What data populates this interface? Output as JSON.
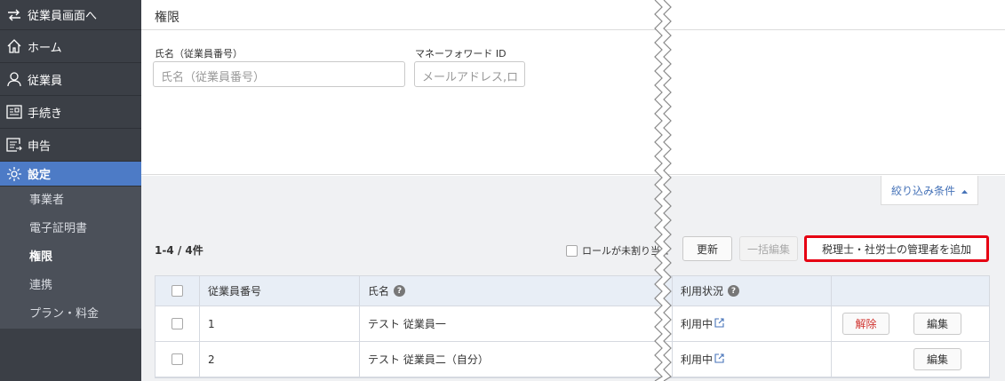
{
  "sidebar": {
    "switch_label": "従業員画面へ",
    "items": [
      {
        "label": "ホーム",
        "icon": "home-icon"
      },
      {
        "label": "従業員",
        "icon": "person-icon"
      },
      {
        "label": "手続き",
        "icon": "procedure-icon"
      },
      {
        "label": "申告",
        "icon": "declaration-icon"
      }
    ],
    "active_label": "設定",
    "sub_items": [
      "事業者",
      "電子証明書",
      "権限",
      "連携",
      "プラン・料金"
    ]
  },
  "page": {
    "title": "権限"
  },
  "filter": {
    "name_label": "氏名（従業員番号）",
    "name_placeholder": "氏名（従業員番号）",
    "mf_label": "マネーフォワード ID",
    "mf_placeholder": "メールアドレス,ロ",
    "collapse_label": "絞り込み条件",
    "collapse_icon": "caret-up-icon"
  },
  "list": {
    "count": "1-4 / 4件",
    "unassigned_label": "ロールが未割り当て",
    "refresh_label": "更新",
    "bulk_edit_label": "一括編集",
    "add_admin_label": "税理士・社労士の管理者を追加"
  },
  "table": {
    "headers": [
      "従業員番号",
      "氏名",
      "利用状況"
    ],
    "rows": [
      {
        "number": "1",
        "name": "テスト 従業員一",
        "status": "利用中",
        "remove_label": "解除",
        "edit_label": "編集"
      },
      {
        "number": "2",
        "name": "テスト 従業員二（自分）",
        "status": "利用中",
        "edit_label": "編集"
      }
    ]
  },
  "colors": {
    "accent": "#4d7bc6",
    "sidebar": "#3b3f46",
    "highlight": "#e60012",
    "link": "#4572b8"
  }
}
